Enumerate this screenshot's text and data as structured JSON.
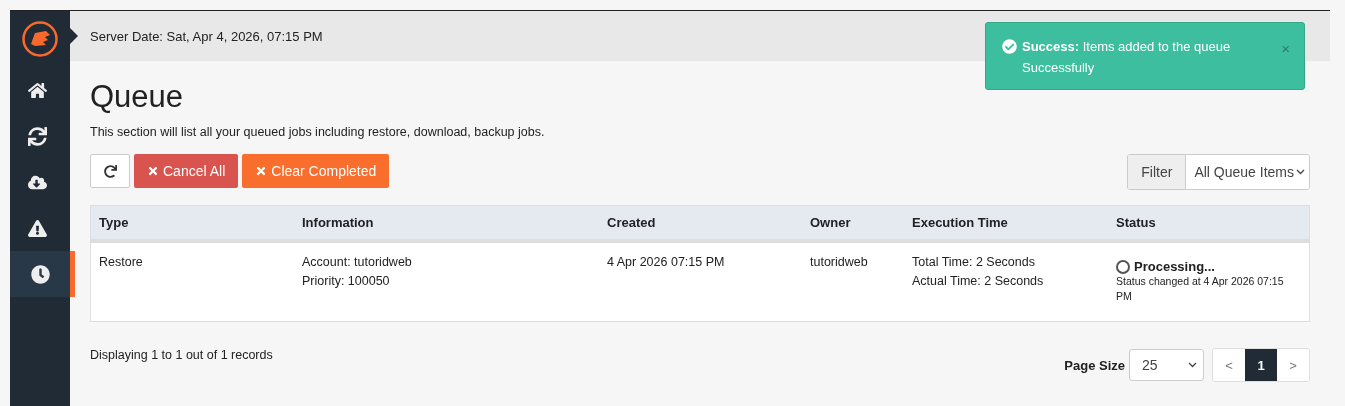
{
  "sidebar": {
    "items": [
      {
        "kind": "home",
        "selected": false
      },
      {
        "kind": "sync",
        "selected": false
      },
      {
        "kind": "cloud",
        "selected": false
      },
      {
        "kind": "warning",
        "selected": false
      },
      {
        "kind": "clock",
        "selected": true
      }
    ]
  },
  "header": {
    "server_date": "Server Date: Sat, Apr 4, 2026, 07:15 PM"
  },
  "toast": {
    "title": "Success:",
    "message": "Items added to the queue Successfully",
    "close": "×"
  },
  "page": {
    "title": "Queue",
    "description": "This section will list all your queued jobs including restore, download, backup jobs."
  },
  "toolbar": {
    "buttons": [
      {
        "kind": "refresh"
      },
      {
        "kind": "danger",
        "label": "Cancel All"
      },
      {
        "kind": "warning",
        "label": "Clear Completed"
      }
    ],
    "filter_label": "Filter",
    "filter_value": "All Queue Items"
  },
  "table": {
    "columns": [
      "Type",
      "Information",
      "Created",
      "Owner",
      "Execution Time",
      "Status"
    ],
    "rows": [
      {
        "type": "Restore",
        "information": [
          "Account: tutoridweb",
          "Priority: 100050"
        ],
        "created": "4 Apr 2026 07:15 PM",
        "owner": "tutoridweb",
        "execution_time": [
          "Total Time: 2 Seconds",
          "Actual Time: 2 Seconds"
        ],
        "status": "Processing...",
        "status_note": "Status changed at 4 Apr 2026 07:15 PM"
      }
    ]
  },
  "footer": {
    "records": "Displaying 1 to 1 out of 1 records",
    "page_size_label": "Page Size",
    "page_size": "25",
    "pages": [
      {
        "label": "<",
        "selected": false
      },
      {
        "label": "1",
        "selected": true
      },
      {
        "label": ">",
        "selected": false
      }
    ]
  }
}
